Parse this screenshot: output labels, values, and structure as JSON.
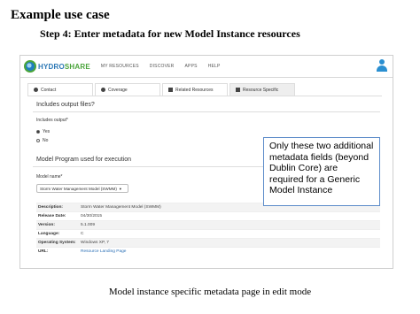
{
  "slide": {
    "title": "Example use case",
    "subtitle": "Step 4: Enter metadata for new Model Instance resources",
    "caption": "Model instance specific metadata page in edit mode"
  },
  "app": {
    "logo_hydro": "HYDRO",
    "logo_share": "SHARE",
    "nav": [
      "MY RESOURCES",
      "DISCOVER",
      "APPS",
      "HELP"
    ],
    "colors": {
      "logo_blue": "#2b77b5",
      "logo_green": "#4aa43b",
      "user_icon": "#2a8fd1",
      "link": "#2a6fb5"
    }
  },
  "tabs": [
    {
      "label": "Contact",
      "icon": "person-icon"
    },
    {
      "label": "Coverage",
      "icon": "globe-icon"
    },
    {
      "label": "Related Resources",
      "icon": "document-icon"
    },
    {
      "label": "Resource Specific",
      "icon": "folder-icon",
      "active": true
    }
  ],
  "output_section": {
    "heading": "Includes output files?",
    "field_label": "Includes output*",
    "options": [
      "Yes",
      "No"
    ],
    "selected": "Yes"
  },
  "program_section": {
    "heading": "Model Program used for execution",
    "field_label": "Model name*",
    "selected_value": "Storm Water Management Model (SWMM)"
  },
  "metadata": [
    {
      "key": "Description:",
      "value": "Storm Water Management Model (SWMM)"
    },
    {
      "key": "Release Date:",
      "value": "04/30/2015"
    },
    {
      "key": "Version:",
      "value": "5.1.009"
    },
    {
      "key": "Language:",
      "value": "C"
    },
    {
      "key": "Operating System:",
      "value": "Windows XP, 7"
    },
    {
      "key": "URL:",
      "value": "Resource Landing Page",
      "link": true
    }
  ],
  "callout": "Only these two additional metadata fields (beyond Dublin Core) are required for a Generic Model Instance"
}
